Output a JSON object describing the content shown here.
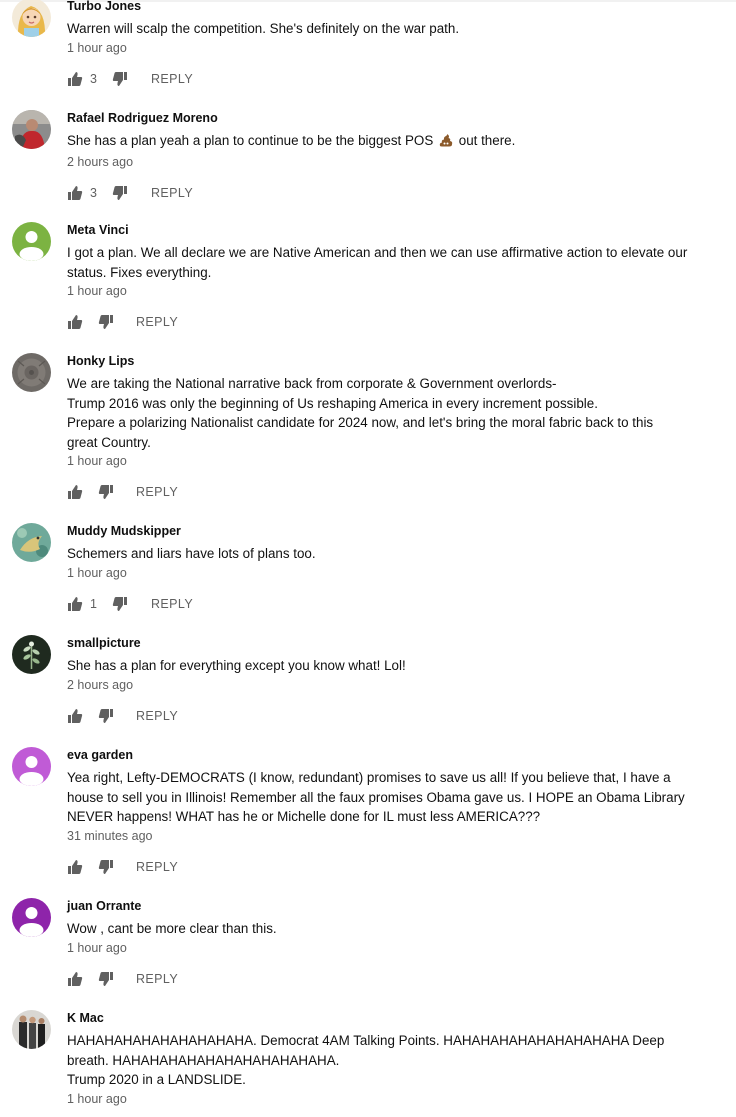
{
  "comments": [
    {
      "author": "Turbo Jones",
      "lines": [
        "Warren will scalp the competition.   She's definitely on the war path."
      ],
      "time": "1 hour ago",
      "likes": "3",
      "reply": "REPLY",
      "avatar": "cartoon-girl"
    },
    {
      "author": "Rafael Rodriguez Moreno",
      "lines": [
        "She has a plan yeah a plan to continue to be the biggest POS",
        "out there."
      ],
      "time": "2 hours ago",
      "likes": "3",
      "reply": "REPLY",
      "avatar": "photo-red"
    },
    {
      "author": "Meta Vinci",
      "lines": [
        "I got a plan. We all declare we are Native American and then we can use affirmative action to elevate our",
        "status. Fixes everything."
      ],
      "time": "1 hour ago",
      "likes": "",
      "reply": "REPLY",
      "avatar": "default-green"
    },
    {
      "author": "Honky Lips",
      "lines": [
        "We are taking the National narrative back from corporate & Government overlords-",
        "Trump 2016 was only the beginning of Us reshaping America in every increment possible.",
        "Prepare a polarizing Nationalist candidate for 2024 now, and let's bring the moral fabric back to this",
        "great Country."
      ],
      "time": "1 hour ago",
      "likes": "",
      "reply": "REPLY",
      "avatar": "photo-gray"
    },
    {
      "author": "Muddy Mudskipper",
      "lines": [
        "Schemers and liars have lots of plans too."
      ],
      "time": "1 hour ago",
      "likes": "1",
      "reply": "REPLY",
      "avatar": "photo-teal"
    },
    {
      "author": "smallpicture",
      "lines": [
        "She has a plan for everything except you know what! Lol!"
      ],
      "time": "2 hours ago",
      "likes": "",
      "reply": "REPLY",
      "avatar": "photo-dark-plant"
    },
    {
      "author": "eva garden",
      "lines": [
        "Yea right, Lefty-DEMOCRATS (I know, redundant) promises to save us all!  If you believe that, I have a",
        "house to sell you in Illinois!  Remember all the faux promises Obama gave us.  I HOPE an Obama Library",
        "NEVER happens!  WHAT has he or Michelle done for IL must less AMERICA???"
      ],
      "time": "31 minutes ago",
      "likes": "",
      "reply": "REPLY",
      "avatar": "default-magenta"
    },
    {
      "author": "juan Orrante",
      "lines": [
        "Wow , cant be more clear than this."
      ],
      "time": "1 hour ago",
      "likes": "",
      "reply": "REPLY",
      "avatar": "default-purple"
    },
    {
      "author": "K Mac",
      "lines": [
        "HAHAHAHAHAHAHAHAHAHA.  Democrat 4AM Talking Points.   HAHAHAHAHAHAHAHAHAHA  Deep",
        "breath.  HAHAHAHAHAHAHAHAHAHAHAHA.",
        "Trump 2020 in a LANDSLIDE."
      ],
      "time": "1 hour ago",
      "likes": "",
      "reply": "",
      "avatar": "photo-people"
    }
  ],
  "icons": {
    "like": "thumbs-up-icon",
    "dislike": "thumbs-down-icon",
    "emoji": "poop-emoji"
  },
  "colors": {
    "default_green": "#7cb342",
    "default_magenta": "#c05bd6",
    "default_purple": "#8e24aa",
    "meta_gray": "#606060"
  }
}
